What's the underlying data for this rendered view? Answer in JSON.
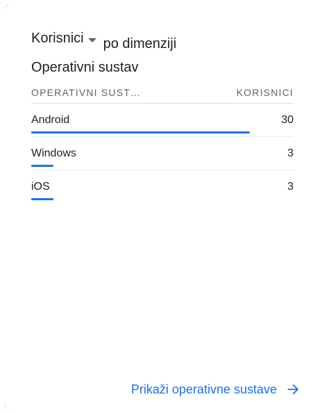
{
  "header": {
    "metric_label": "Korisnici",
    "title_suffix": "po dimenziji",
    "dimension_title": "Operativni sustav"
  },
  "table": {
    "columns": [
      "OPERATIVNI SUST…",
      "KORISNICI"
    ],
    "rows": [
      {
        "label": "Android",
        "value": "30",
        "share": 1.0
      },
      {
        "label": "Windows",
        "value": "3",
        "share": 0.1
      },
      {
        "label": "iOS",
        "value": "3",
        "share": 0.1
      }
    ]
  },
  "footer": {
    "link_label": "Prikaži operativne sustave"
  },
  "colors": {
    "accent": "#1a73e8",
    "text": "#202124",
    "muted": "#5f6368"
  }
}
